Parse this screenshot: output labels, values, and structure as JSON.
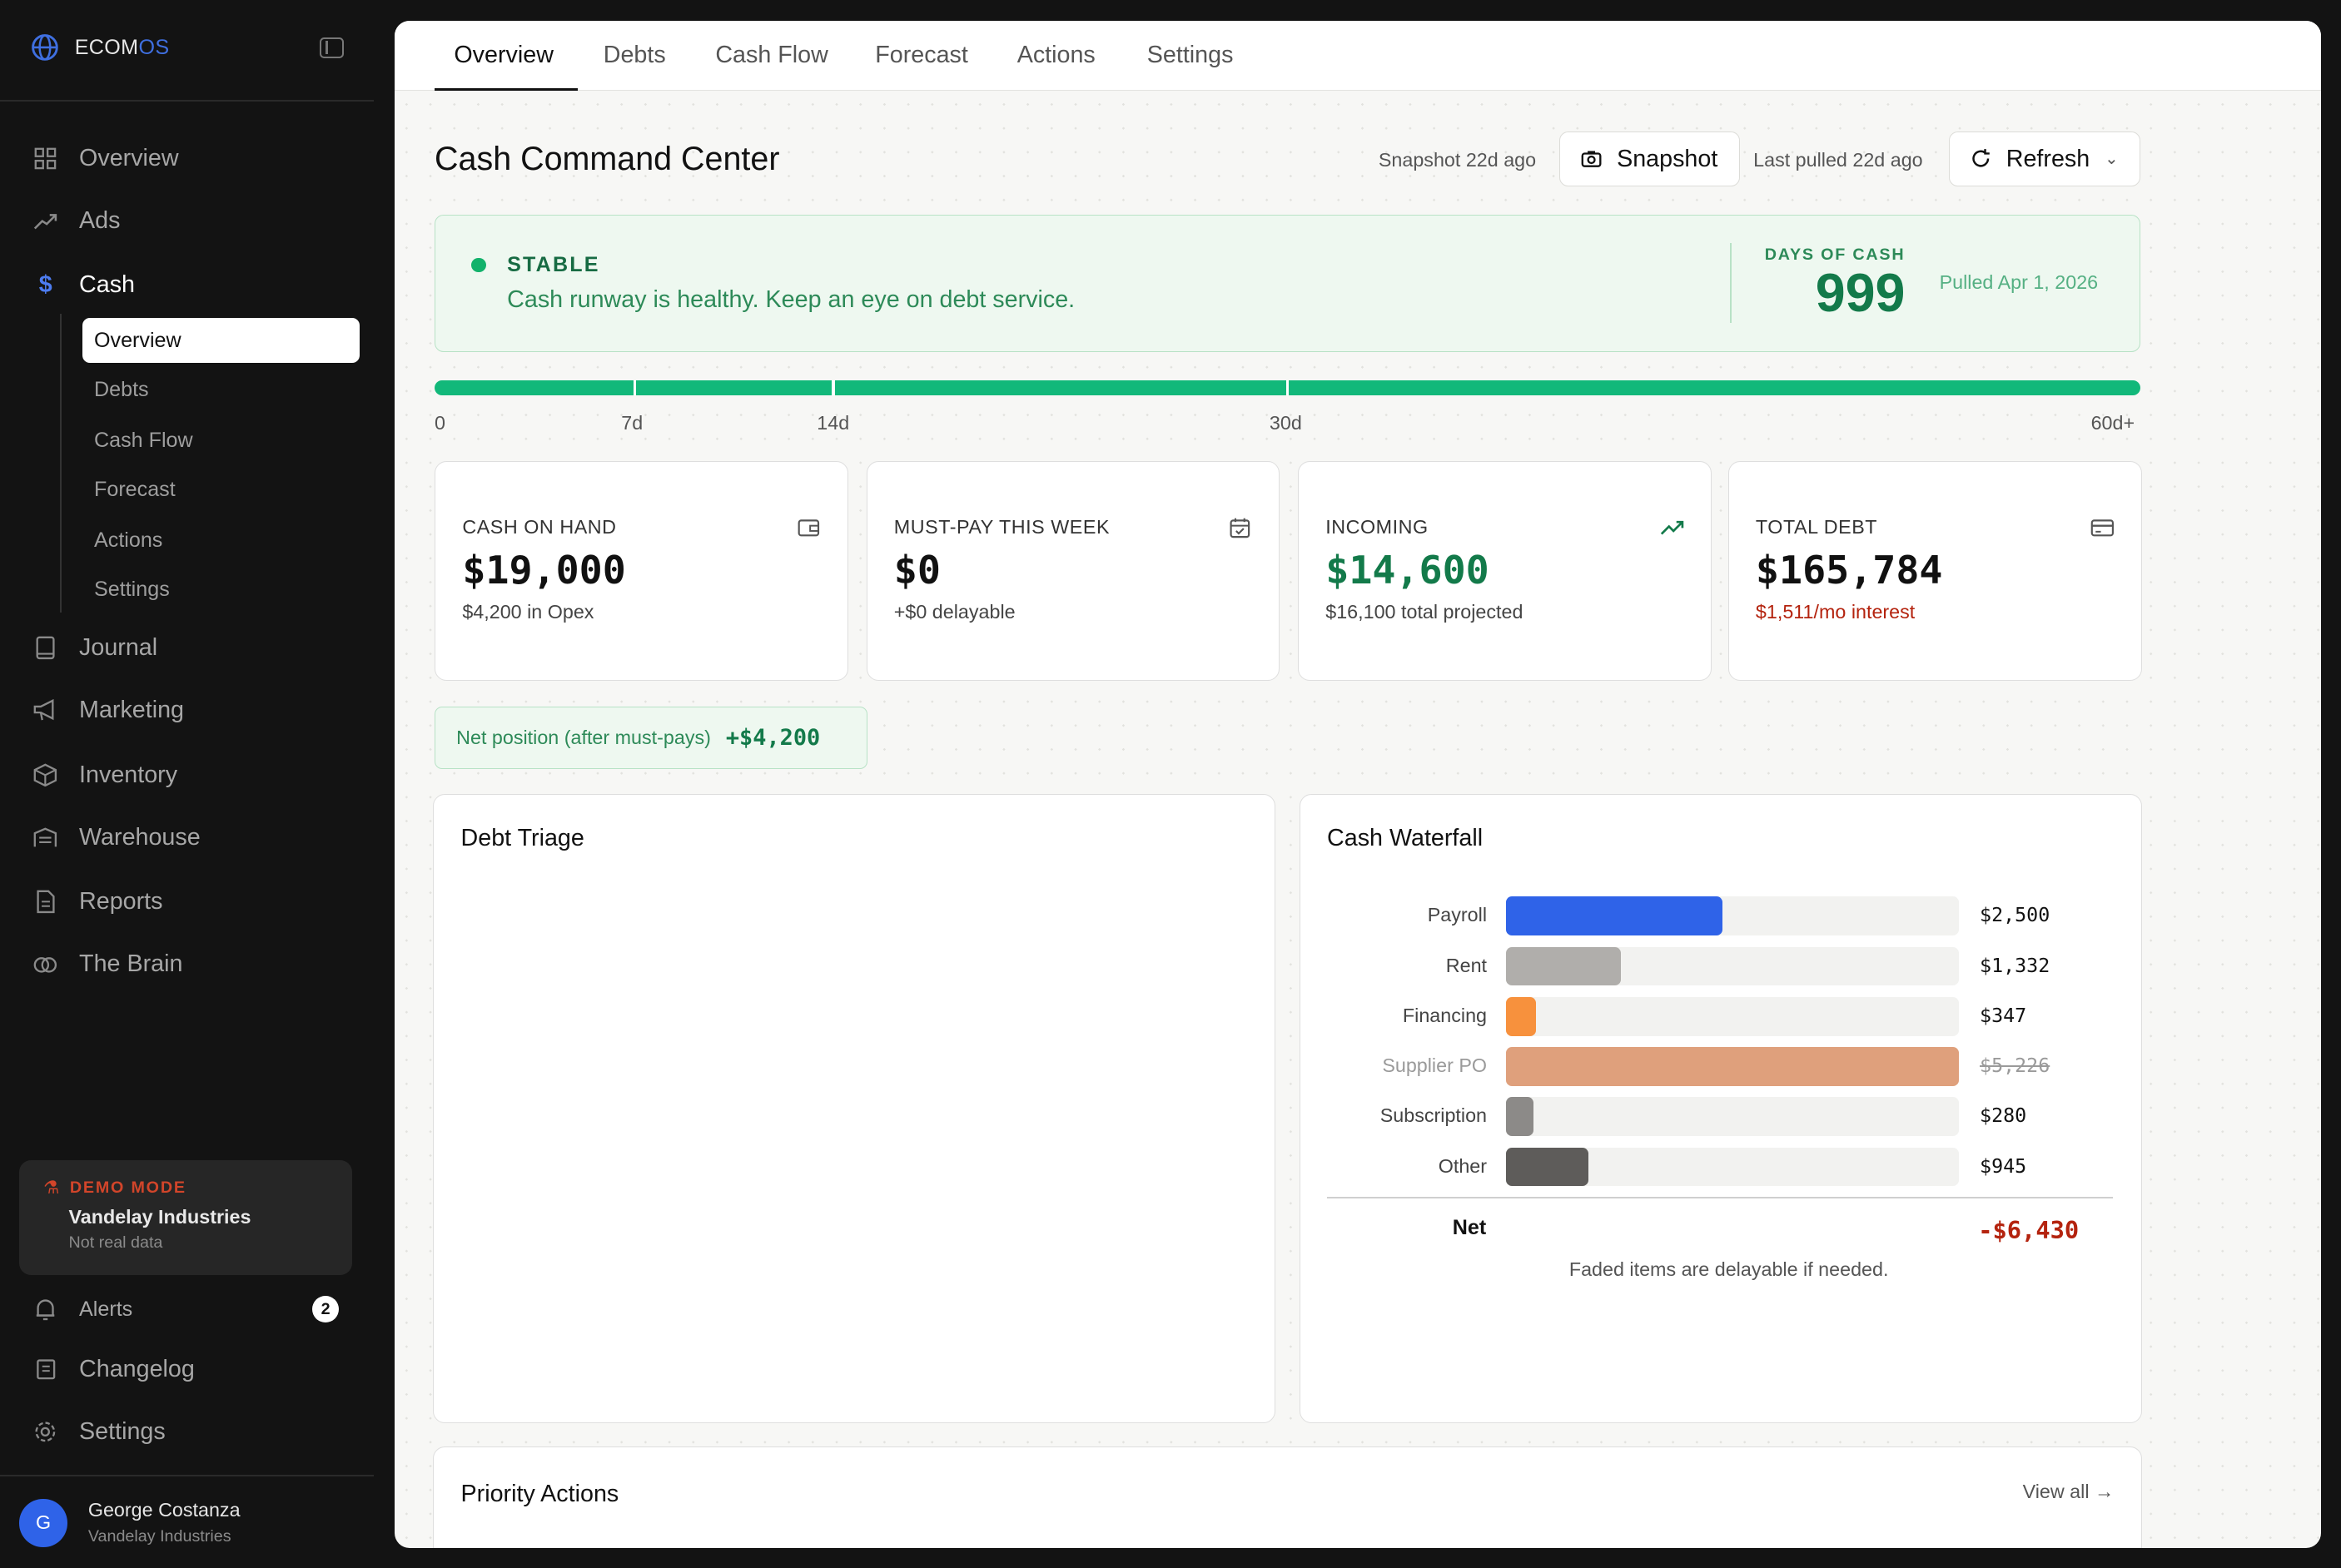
{
  "brand": {
    "name_main": "ECOM",
    "name_accent": "OS",
    "logo_icon": "globe-icon"
  },
  "sidebar": {
    "nav": [
      {
        "label": "Overview",
        "icon": "grid-icon"
      },
      {
        "label": "Ads",
        "icon": "trend-icon"
      },
      {
        "label": "Cash",
        "icon": "dollar-icon",
        "active": true
      },
      {
        "label": "Journal",
        "icon": "book-icon"
      },
      {
        "label": "Marketing",
        "icon": "megaphone-icon"
      },
      {
        "label": "Inventory",
        "icon": "box-icon"
      },
      {
        "label": "Warehouse",
        "icon": "warehouse-icon"
      },
      {
        "label": "Reports",
        "icon": "report-icon"
      },
      {
        "label": "The Brain",
        "icon": "brain-icon"
      }
    ],
    "cash_sub": [
      "Overview",
      "Debts",
      "Cash Flow",
      "Forecast",
      "Actions",
      "Settings"
    ],
    "demo": {
      "tag": "DEMO MODE",
      "org": "Vandelay Industries",
      "note": "Not real data"
    },
    "bottom": [
      {
        "label": "Alerts",
        "icon": "bell-icon",
        "badge": "2"
      },
      {
        "label": "Changelog",
        "icon": "changelog-icon"
      },
      {
        "label": "Settings",
        "icon": "gear-icon"
      }
    ],
    "user": {
      "initial": "G",
      "name": "George Costanza",
      "org": "Vandelay Industries"
    }
  },
  "tabs": [
    "Overview",
    "Debts",
    "Cash Flow",
    "Forecast",
    "Actions",
    "Settings"
  ],
  "header": {
    "title": "Cash Command Center",
    "snapshot_label": "Snapshot 22d ago",
    "snapshot_button": "Snapshot",
    "pulled_label": "Last pulled 22d ago",
    "refresh_button": "Refresh"
  },
  "status": {
    "label": "STABLE",
    "message": "Cash runway is healthy. Keep an eye on debt service.",
    "days_label": "DAYS OF CASH",
    "days_value": "999",
    "pulled": "Pulled Apr 1, 2026",
    "color": "#12b26b"
  },
  "runway": {
    "ticks": [
      "0",
      "7d",
      "14d",
      "30d",
      "60d+"
    ]
  },
  "kpis": [
    {
      "label": "CASH ON HAND",
      "value": "$19,000",
      "sub": "$4,200 in Opex",
      "icon": "wallet-icon"
    },
    {
      "label": "MUST-PAY THIS WEEK",
      "value": "$0",
      "sub": "+$0 delayable",
      "icon": "calendar-check-icon"
    },
    {
      "label": "INCOMING",
      "value": "$14,600",
      "sub": "$16,100 total projected",
      "icon": "trending-up-icon"
    },
    {
      "label": "TOTAL DEBT",
      "value": "$165,784",
      "sub": "$1,511/mo interest",
      "icon": "credit-card-icon"
    }
  ],
  "net_position": {
    "label": "Net position (after must-pays)",
    "value": "+$4,200"
  },
  "debt_triage": {
    "title": "Debt Triage"
  },
  "waterfall": {
    "title": "Cash Waterfall",
    "net_label": "Net",
    "net_value": "-$6,430",
    "note": "Faded items are delayable if needed."
  },
  "chart_data": {
    "type": "bar",
    "orientation": "horizontal",
    "categories": [
      "Payroll",
      "Rent",
      "Financing",
      "Supplier PO",
      "Subscription",
      "Other"
    ],
    "values": [
      2500,
      1332,
      347,
      5226,
      280,
      945
    ],
    "labels": [
      "$2,500",
      "$1,332",
      "$347",
      "$5,226",
      "$280",
      "$945"
    ],
    "delayable": [
      false,
      false,
      false,
      true,
      false,
      false
    ],
    "colors": [
      "#2f63e8",
      "#b0aeab",
      "#f7913d",
      "#dfa07c",
      "#8c8a88",
      "#5e5c5a"
    ],
    "xlim": [
      0,
      5226
    ]
  },
  "priority": {
    "title": "Priority Actions",
    "view_all": "View all →"
  }
}
